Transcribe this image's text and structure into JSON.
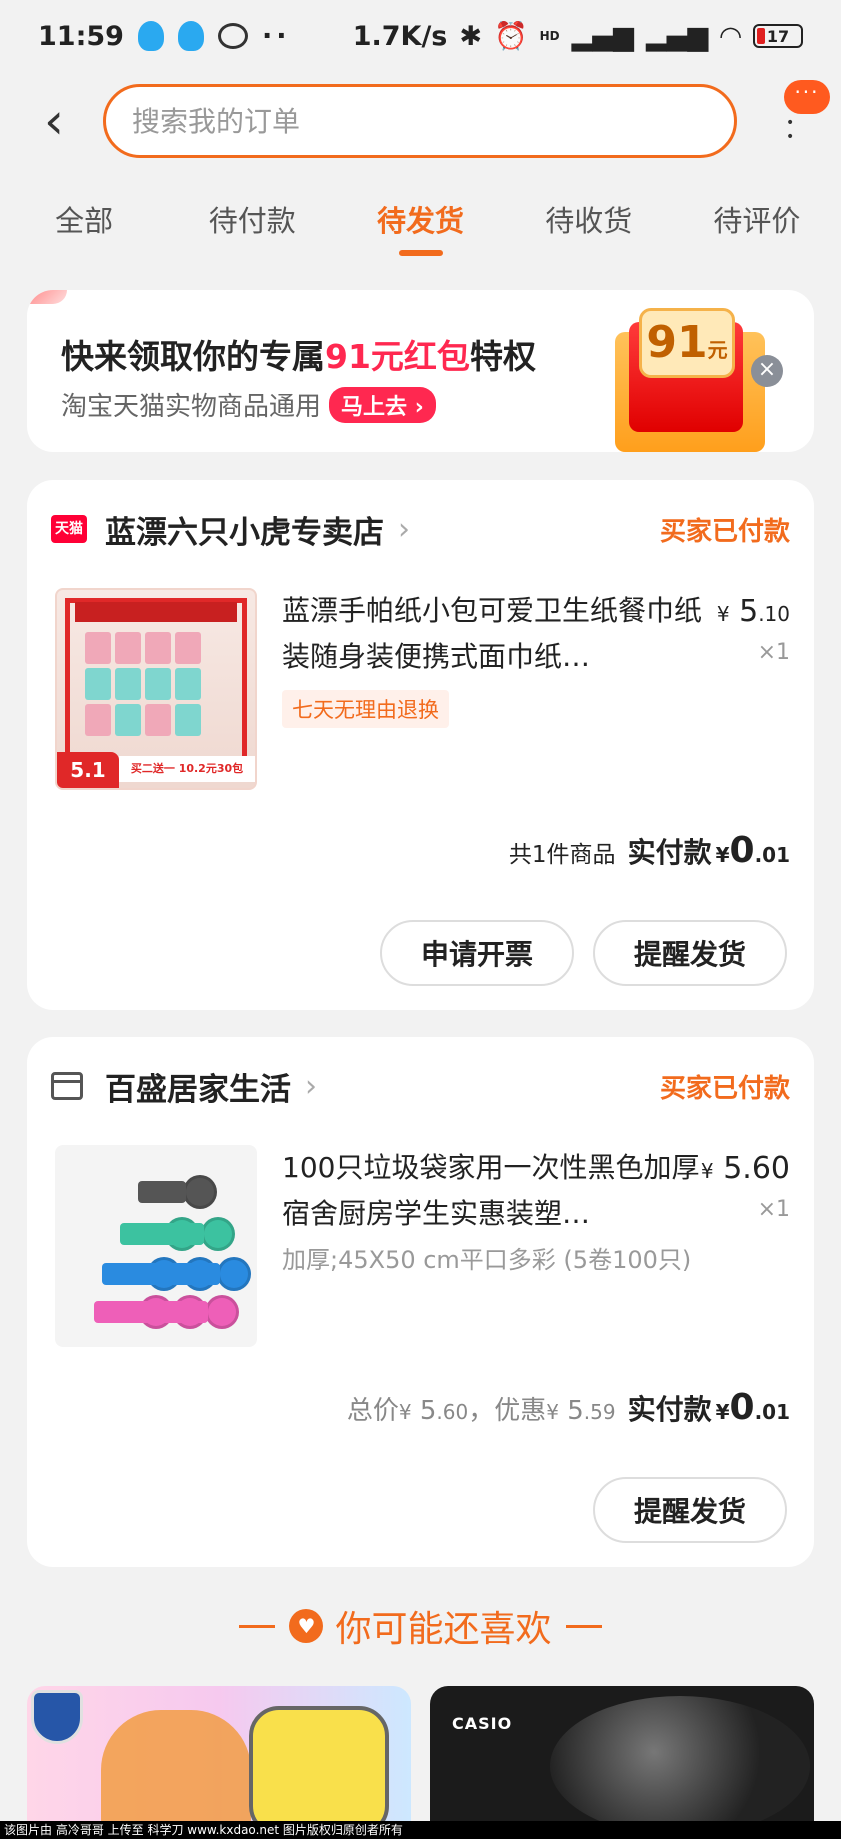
{
  "status_bar": {
    "time": "11:59",
    "dots": "··",
    "network_speed": "1.7K/s",
    "hd_label": "HD",
    "battery": "17"
  },
  "header": {
    "search_placeholder": "搜索我的订单",
    "more_bubble": "···"
  },
  "tabs": [
    {
      "label": "全部",
      "active": false
    },
    {
      "label": "待付款",
      "active": false
    },
    {
      "label": "待发货",
      "active": true
    },
    {
      "label": "待收货",
      "active": false
    },
    {
      "label": "待评价",
      "active": false
    }
  ],
  "promo": {
    "title_prefix": "快来领取你的专属",
    "title_highlight": "91元红包",
    "title_suffix": "特权",
    "subtitle": "淘宝天猫实物商品通用",
    "cta": "马上去",
    "chest_amount": "91",
    "chest_unit": "元"
  },
  "orders": [
    {
      "shop_badge": "天猫",
      "shop_name": "蓝漂六只小虎专卖店",
      "status": "买家已付款",
      "product_title": "蓝漂手帕纸小包可爱卫生纸餐巾纸装随身装便携式面巾纸…",
      "price_int": "5",
      "price_dec": ".10",
      "qty": "×1",
      "tag": "七天无理由退换",
      "thumb_tag": "5.1",
      "thumb_bar": "买二送一 10.2元30包",
      "summary_count": "共1件商品",
      "paid_label": "实付款",
      "paid_int": "0",
      "paid_dec": ".01",
      "buttons": [
        "申请开票",
        "提醒发货"
      ]
    },
    {
      "shop_name": "百盛居家生活",
      "status": "买家已付款",
      "product_title": "100只垃圾袋家用一次性黑色加厚宿舍厨房学生实惠装塑…",
      "price_int": "5",
      "price_dec": ".60",
      "qty": "×1",
      "spec": "加厚;45X50 cm平口多彩 (5卷100只)",
      "total_label": "总价",
      "total_int": "5",
      "total_dec": ".60",
      "discount_label": "，优惠",
      "discount_int": "5",
      "discount_dec": ".59",
      "paid_label": "实付款",
      "paid_int": "0",
      "paid_dec": ".01",
      "buttons": [
        "提醒发货"
      ]
    }
  ],
  "currency": "¥",
  "recommend": {
    "title": "你可能还喜欢",
    "item2_brand": "CASIO"
  },
  "footer": "该图片由 高冷哥哥 上传至 科学刀 www.kxdao.net 图片版权归原创者所有",
  "colors": {
    "accent": "#f26b1d",
    "promo_red": "#ff2850",
    "background": "#f2f2f2"
  }
}
